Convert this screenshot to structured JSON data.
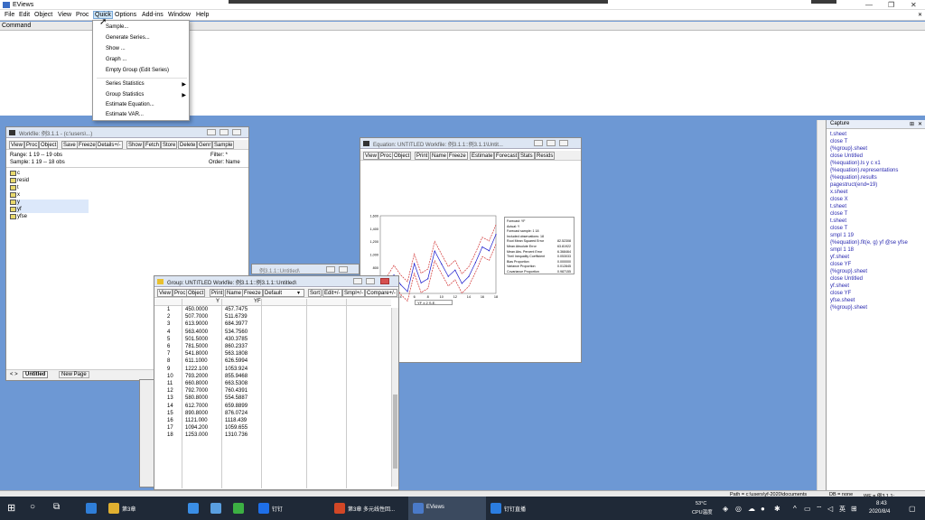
{
  "app": {
    "title": "EViews"
  },
  "menu": [
    "File",
    "Edit",
    "Object",
    "View",
    "Proc",
    "Quick",
    "Options",
    "Add-ins",
    "Window",
    "Help"
  ],
  "command_label": "Command",
  "quick_menu": {
    "items": [
      "Sample...",
      "Generate Series...",
      "Show ...",
      "Graph ...",
      "Empty Group (Edit Series)",
      "Series Statistics",
      "Group Statistics",
      "Estimate Equation...",
      "Estimate VAR..."
    ]
  },
  "capture": {
    "title": "Capture",
    "lines": [
      "t.sheet",
      "close T",
      "{%group}.sheet",
      "close Untitled",
      "{%equation}.ls y c x1",
      "{%equation}.representations",
      "{%equation}.results",
      "pagestruct(end=19)",
      "x.sheet",
      "close X",
      "t.sheet",
      "close T",
      "t.sheet",
      "close T",
      "smpl 1 19",
      "{%equation}.fit(e, g) yf @se yfse",
      "smpl 1 18",
      "yf.sheet",
      "close YF",
      "{%group}.sheet",
      "close Untitled",
      "yf.sheet",
      "close YF",
      "yfse.sheet",
      "{%group}.sheet"
    ]
  },
  "workfile": {
    "title": "Workfile: 例3.1.1 - (c:\\users\\...)",
    "toolbar": [
      "View",
      "Proc",
      "Object",
      "Save",
      "Freeze",
      "Details+/-",
      "Show",
      "Fetch",
      "Store",
      "Delete",
      "Genr",
      "Sample"
    ],
    "range": "Range:  1 19  --  19 obs",
    "filter": "Filter: *",
    "sample": "Sample: 1 19  --  18 obs",
    "order": "Order: Name",
    "items": [
      "c",
      "resid",
      "t",
      "x",
      "y",
      "yf",
      "yfse"
    ],
    "tabs": [
      "Untitled",
      "New Page"
    ]
  },
  "equation": {
    "title": "Equation: UNTITLED   Workfile: 例3.1.1::例3.1.1\\Untit...",
    "toolbar": [
      "View",
      "Proc",
      "Object",
      "Print",
      "Name",
      "Freeze",
      "Estimate",
      "Forecast",
      "Stats",
      "Resids"
    ],
    "forecast_box": [
      "Forecast: YF",
      "Actual: Y",
      "Forecast sample: 1 18",
      "Included observations: 18",
      "Root Mean Squared Error",
      "Mean Absolute Error",
      "Mean Abs. Percent Error",
      "Theil Inequality Coefficient",
      "Bias Proportion",
      "Variance Proportion",
      "Covariance Proportion"
    ],
    "forecast_values": [
      "82.52308",
      "63.81922",
      "6.368464",
      "0.053033",
      "0.000000",
      "0.012845",
      "0.987155"
    ],
    "y_ticks": [
      "1,600",
      "1,400",
      "1,200",
      "1,000",
      "800",
      "600",
      "400"
    ],
    "x_ticks": [
      "2",
      "4",
      "6",
      "8",
      "10",
      "12",
      "14",
      "16",
      "18"
    ],
    "legend": "YF ± 2 S.E."
  },
  "behind_title": "例3.1.1::Untitled\\",
  "group": {
    "title": "Group: UNTITLED   Workfile: 例3.1.1::例3.1.1::Untitled\\",
    "toolbar": [
      "View",
      "Proc",
      "Object",
      "Print",
      "Name",
      "Freeze",
      "Default",
      "Sort",
      "Edit+/-",
      "Smpl+/-",
      "Compare+/-"
    ],
    "headers": [
      "Y",
      "YF"
    ],
    "rows": [
      [
        "1",
        "450.0000",
        "457.7475"
      ],
      [
        "2",
        "507.7000",
        "511.6739"
      ],
      [
        "3",
        "613.9000",
        "684.3977"
      ],
      [
        "4",
        "563.4000",
        "534.7560"
      ],
      [
        "5",
        "501.5000",
        "430.3785"
      ],
      [
        "6",
        "781.5000",
        "860.2337"
      ],
      [
        "7",
        "541.8000",
        "563.1808"
      ],
      [
        "8",
        "611.1000",
        "626.5994"
      ],
      [
        "9",
        "1222.100",
        "1053.924"
      ],
      [
        "10",
        "793.2000",
        "855.9468"
      ],
      [
        "11",
        "660.8000",
        "663.5308"
      ],
      [
        "12",
        "792.7000",
        "760.4391"
      ],
      [
        "13",
        "580.8000",
        "554.5887"
      ],
      [
        "14",
        "612.7000",
        "659.8899"
      ],
      [
        "15",
        "890.8000",
        "876.0724"
      ],
      [
        "16",
        "1121.000",
        "1118.439"
      ],
      [
        "17",
        "1094.200",
        "1059.655"
      ],
      [
        "18",
        "1253.000",
        "1310.736"
      ]
    ]
  },
  "status": {
    "path": "Path = c:\\users\\yf-2020\\documents",
    "db": "DB = none",
    "wf": "WF = 例3.1.1:"
  },
  "taskbar": {
    "items": [
      "第3章",
      "钉钉",
      "第3章 多元线性回...",
      "EViews",
      "钉钉直播"
    ],
    "temp": "53°C",
    "cpu": "CPU温度",
    "ime": "英",
    "time": "8:43",
    "date": "2020/8/4"
  },
  "chart_data": {
    "type": "line",
    "x": [
      1,
      2,
      3,
      4,
      5,
      6,
      7,
      8,
      9,
      10,
      11,
      12,
      13,
      14,
      15,
      16,
      17,
      18
    ],
    "series": [
      {
        "name": "YF",
        "values": [
          457.7475,
          511.6739,
          684.3977,
          534.756,
          430.3785,
          860.2337,
          563.1808,
          626.5994,
          1053.924,
          855.9468,
          663.5308,
          760.4391,
          554.5887,
          659.8899,
          876.0724,
          1118.439,
          1059.655,
          1310.736
        ]
      }
    ],
    "ylim": [
      400,
      1600
    ],
    "legend": "bottom"
  },
  "colors": {
    "accent": "#2b2bb0",
    "forecast": "#1a1acc",
    "bands": "#d03030"
  }
}
